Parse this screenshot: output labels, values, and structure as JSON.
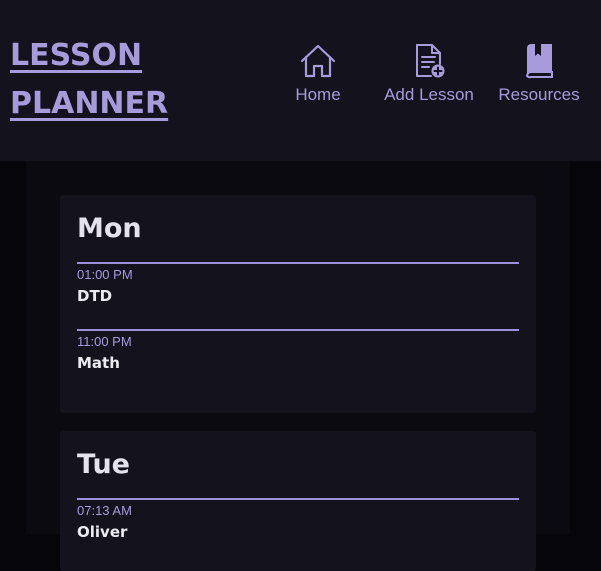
{
  "header": {
    "logo_line1": "LESSON",
    "logo_line2": "PLANNER",
    "nav": [
      {
        "label": "Home",
        "icon": "home-icon"
      },
      {
        "label": "Add Lesson",
        "icon": "document-add-icon"
      },
      {
        "label": "Resources",
        "icon": "book-icon"
      }
    ]
  },
  "days": [
    {
      "name": "Mon",
      "lessons": [
        {
          "time": "01:00 PM",
          "subject": "DTD"
        },
        {
          "time": "11:00 PM",
          "subject": "Math"
        }
      ]
    },
    {
      "name": "Tue",
      "lessons": [
        {
          "time": "07:13 AM",
          "subject": "Oliver"
        }
      ]
    }
  ],
  "colors": {
    "accent": "#a79bdb",
    "header_bg": "#14121d",
    "page_bg": "#060509",
    "card_bg": "#14121d",
    "divider": "#9d8fd9"
  }
}
